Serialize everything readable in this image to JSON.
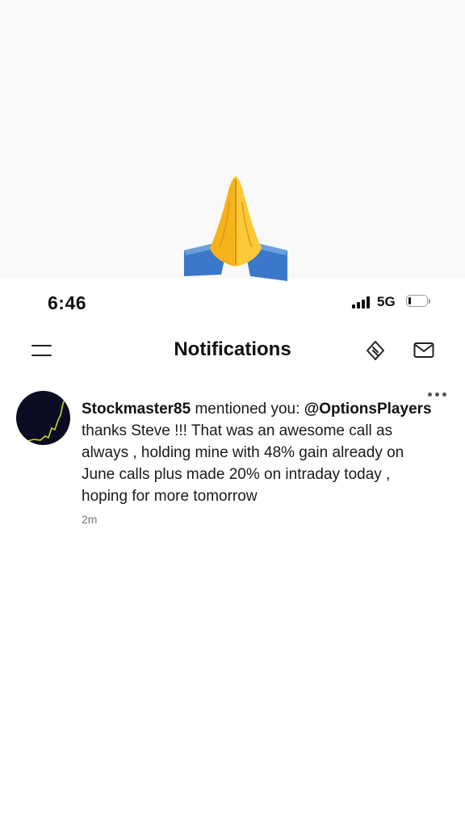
{
  "emoji": {
    "name": "folded-hands-emoji"
  },
  "status_bar": {
    "time": "6:46",
    "network": "5G",
    "battery_level_percent": 15
  },
  "header": {
    "title": "Notifications",
    "icons": [
      "menu-icon",
      "diamond-icon",
      "mail-icon"
    ]
  },
  "notification": {
    "username": "Stockmaster85",
    "action_text": " mentioned you: ",
    "mention": "@OptionsPlayers",
    "body_lines": [
      "thanks Steve !!! That was an awesome call as",
      "always , holding mine with 48% gain already on",
      "June calls plus made 20% on intraday today ,",
      "hoping for more tomorrow"
    ],
    "time": "2m"
  },
  "colors": {
    "background": "#ffffff",
    "top_area": "#f9f9f9",
    "avatar_bg": "#0b0b22",
    "chart_line": "#c8d82a"
  }
}
